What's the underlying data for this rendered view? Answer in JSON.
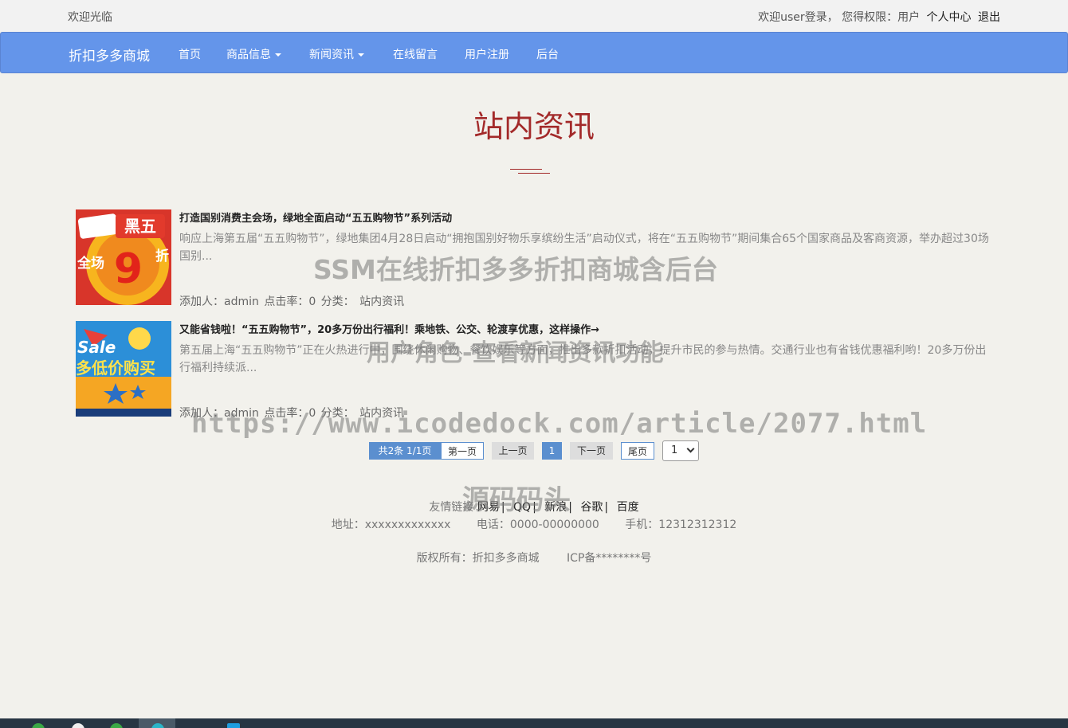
{
  "topbar": {
    "welcome": "欢迎光临",
    "login_text": "欢迎user登录，  您得权限：用户",
    "profile_link": "个人中心",
    "logout_link": "退出"
  },
  "nav": {
    "brand": "折扣多多商城",
    "items": [
      "首页",
      "商品信息",
      "新闻资讯",
      "在线留言",
      "用户注册",
      "后台"
    ]
  },
  "page_title": "站内资讯",
  "news": [
    {
      "title": "打造国别消费主会场，绿地全面启动“五五购物节”系列活动",
      "desc": "响应上海第五届“五五购物节”，绿地集团4月28日启动“拥抱国别好物乐享缤纷生活”启动仪式，将在“五五购物节”期间集合65个国家商品及客商资源，举办超过30场国别...",
      "meta": "添加人：admin   点击率：0   分类：  站内资讯",
      "thumb_text_1": "黑五",
      "thumb_text_2": "全场",
      "thumb_text_3": "9",
      "thumb_text_4": "折"
    },
    {
      "title": "又能省钱啦！“五五购物节”，20多万份出行福利！乘地铁、公交、轮渡享优惠，这样操作→",
      "desc": "第五届上海“五五购物节”正在火热进行中，围绕休闲购物、餐饮娱乐等方面，推出多款折扣活动，提升市民的参与热情。交通行业也有省钱优惠福利哟！20多万份出行福利持续派...",
      "meta": "添加人：admin   点击率：0   分类：  站内资讯",
      "thumb_text_1": "Sale",
      "thumb_text_2": "多低价购买"
    }
  ],
  "pager": {
    "info": "共2条  1/1页",
    "first": "第一页",
    "prev": "上一页",
    "current": "1",
    "next": "下一页",
    "last": "尾页",
    "select_value": "1"
  },
  "footer": {
    "links_label": "友情链接",
    "links": [
      "网易",
      "QQ",
      "新浪",
      "谷歌",
      "百度"
    ],
    "address": "地址：xxxxxxxxxxxxx",
    "phone": "电话：0000-00000000",
    "mobile": "手机：12312312312",
    "copyright": "版权所有：折扣多多商城",
    "icp": "ICP备********号"
  },
  "watermarks": {
    "line1": "SSM在线折扣多多折扣商城含后台",
    "line2": "用户角色-查看新闻资讯功能",
    "line3": "https://www.icodedock.com/article/2077.html",
    "line4": "源码码头"
  },
  "colors": {
    "nav_bg": "#6495ea",
    "title_red": "#a32a2a",
    "pager_blue": "#5b8fcf"
  }
}
